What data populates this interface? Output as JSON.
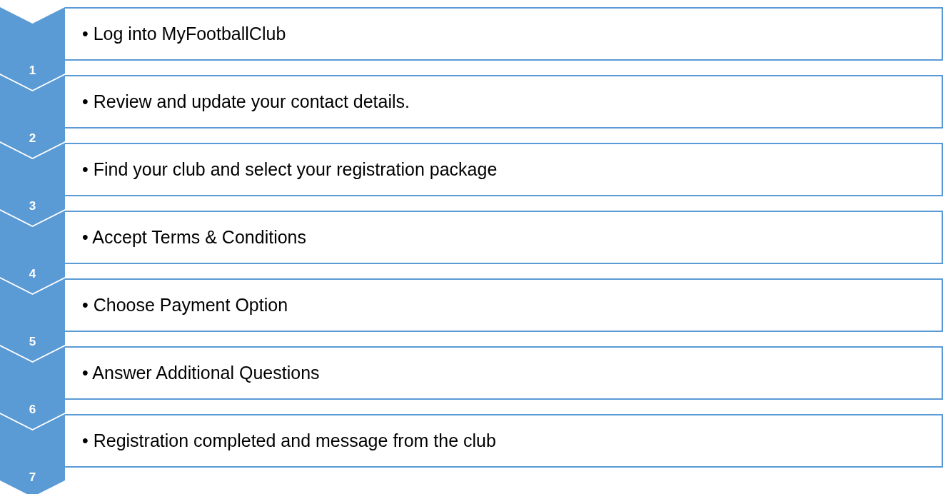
{
  "steps": [
    {
      "number": "1",
      "text": "• Log into MyFootballClub"
    },
    {
      "number": "2",
      "text": "• Review and update your contact details."
    },
    {
      "number": "3",
      "text": "• Find your club and select your registration package"
    },
    {
      "number": "4",
      "text": "• Accept Terms & Conditions"
    },
    {
      "number": "5",
      "text": "• Choose Payment Option"
    },
    {
      "number": "6",
      "text": "• Answer Additional Questions"
    },
    {
      "number": "7",
      "text": "• Registration completed and message from the club"
    }
  ]
}
